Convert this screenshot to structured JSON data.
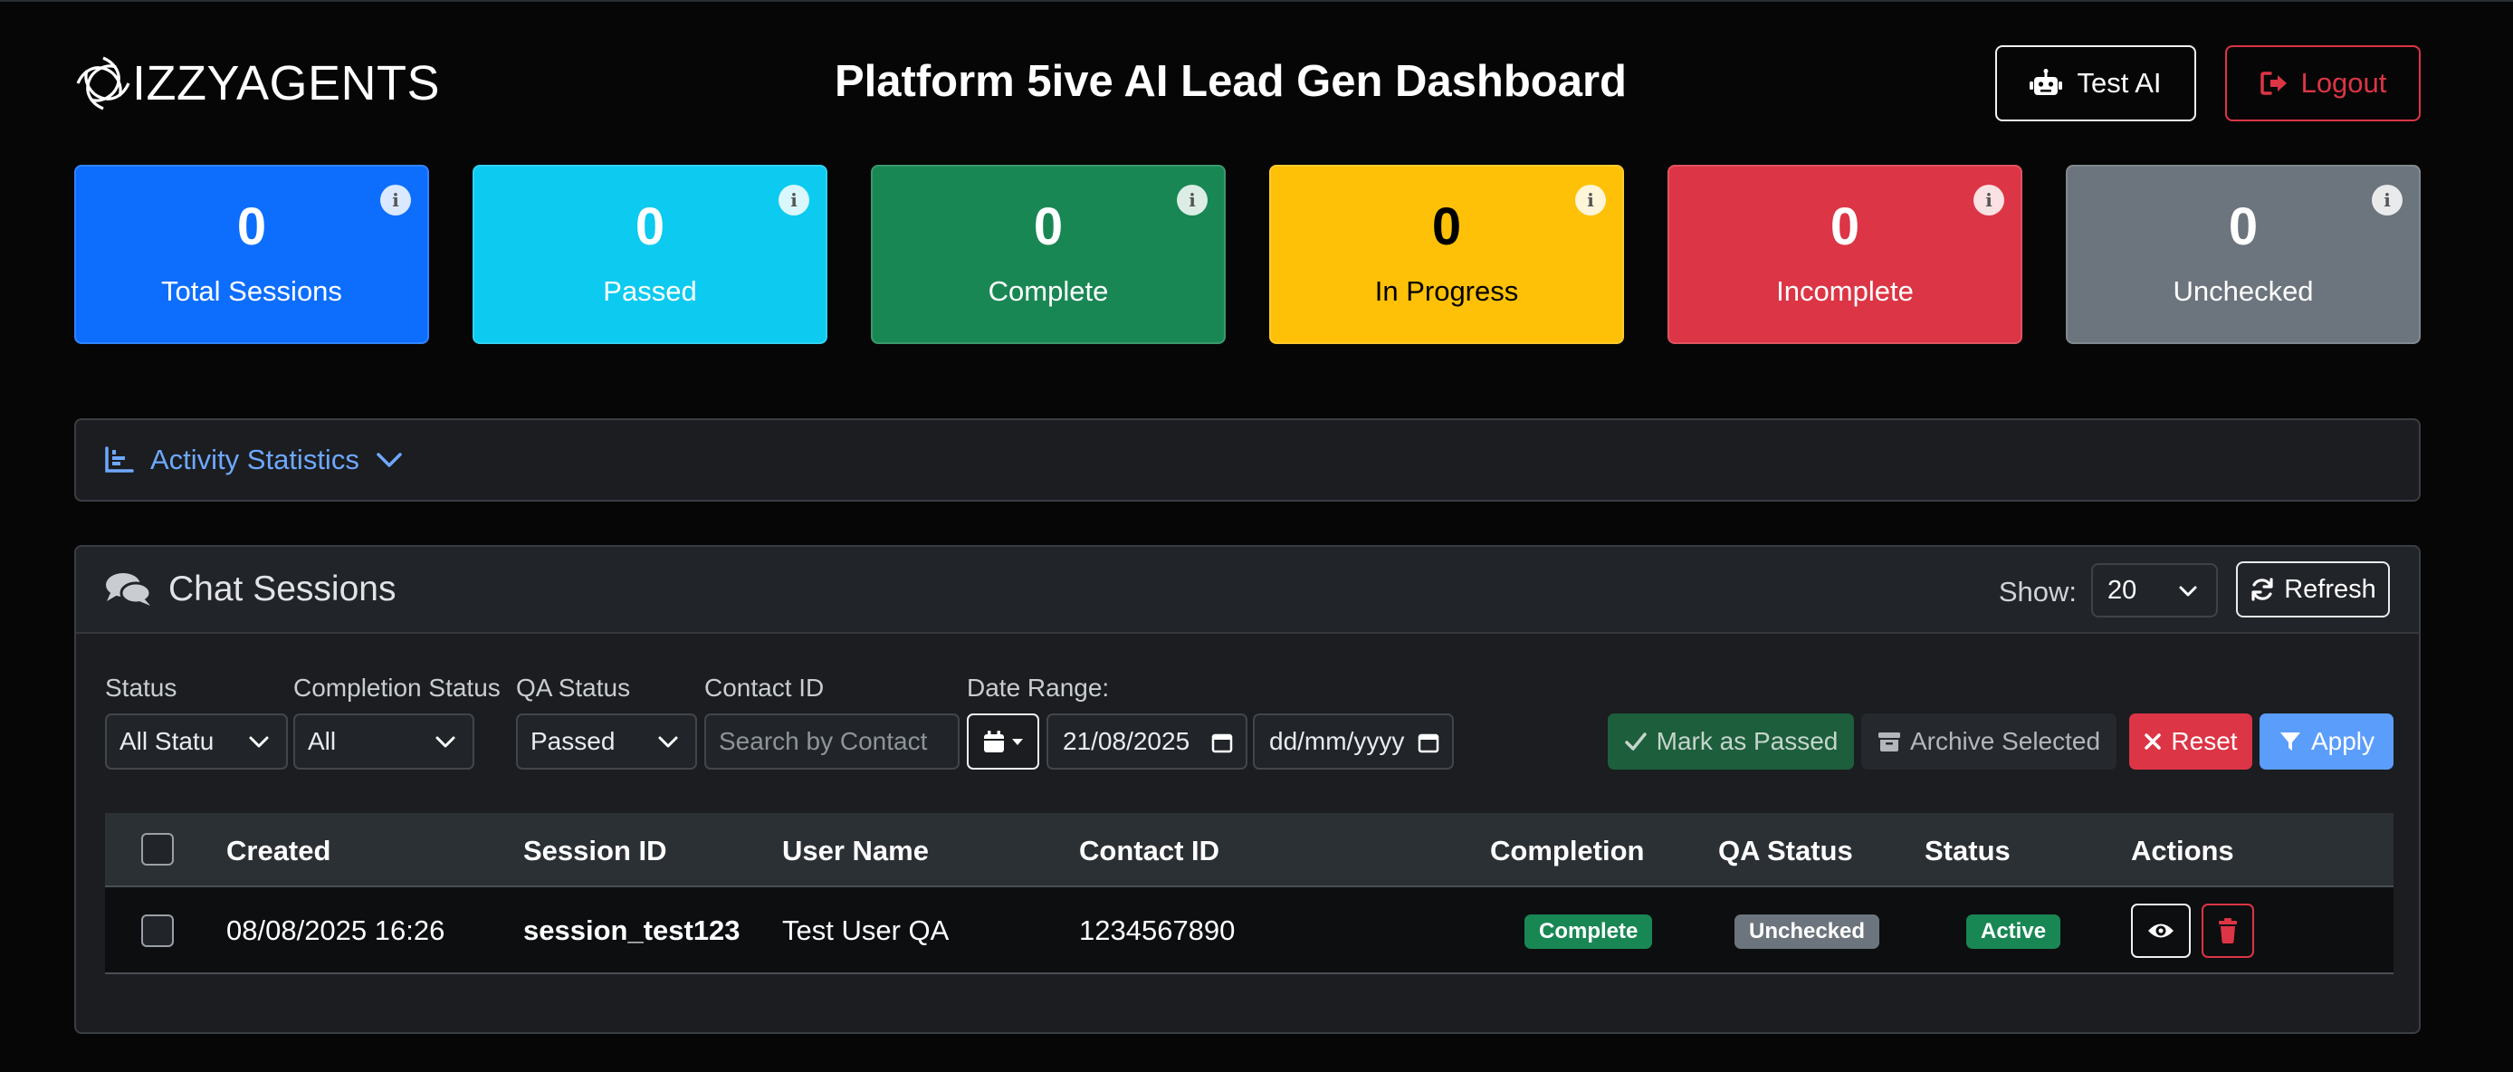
{
  "header": {
    "logo_text": "IZZYAGENTS",
    "title": "Platform 5ive AI Lead Gen Dashboard",
    "test_ai_label": "Test AI",
    "logout_label": "Logout"
  },
  "stats": [
    {
      "value": "0",
      "label": "Total Sessions",
      "color": "#0d6efd"
    },
    {
      "value": "0",
      "label": "Passed",
      "color": "#0dcaf0"
    },
    {
      "value": "0",
      "label": "Complete",
      "color": "#198754"
    },
    {
      "value": "0",
      "label": "In Progress",
      "color": "#ffc107"
    },
    {
      "value": "0",
      "label": "Incomplete",
      "color": "#dc3545"
    },
    {
      "value": "0",
      "label": "Unchecked",
      "color": "#6c757d"
    }
  ],
  "activity": {
    "label": "Activity Statistics"
  },
  "sessions": {
    "title": "Chat Sessions",
    "show_label": "Show:",
    "show_value": "20",
    "refresh_label": "Refresh"
  },
  "filters": {
    "status_label": "Status",
    "status_value": "All Statu",
    "completion_label": "Completion Status",
    "completion_value": "All",
    "qa_label": "QA Status",
    "qa_value": "Passed",
    "contact_label": "Contact ID",
    "contact_placeholder": "Search by Contact",
    "date_label": "Date Range:",
    "date_from": "21/08/2025",
    "date_to": "dd/mm/yyyy",
    "mark_passed_label": "Mark as Passed",
    "archive_label": "Archive Selected",
    "reset_label": "Reset",
    "apply_label": "Apply"
  },
  "table": {
    "columns": [
      "Created",
      "Session ID",
      "User Name",
      "Contact ID",
      "Completion",
      "QA Status",
      "Status",
      "Actions"
    ],
    "rows": [
      {
        "created": "08/08/2025 16:26",
        "session_id": "session_test123",
        "user_name": "Test User QA",
        "contact_id": "1234567890",
        "completion": "Complete",
        "qa_status": "Unchecked",
        "status": "Active"
      }
    ]
  }
}
